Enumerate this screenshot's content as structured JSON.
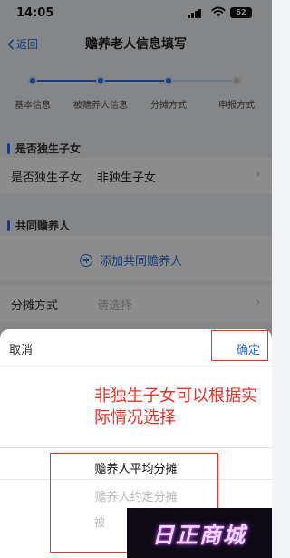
{
  "status_bar": {
    "time": "14:05",
    "battery": "62"
  },
  "nav": {
    "back_label": "返回",
    "title": "赡养老人信息填写"
  },
  "steps": [
    {
      "label": "基本信息",
      "state": "done"
    },
    {
      "label": "被赡养人信息",
      "state": "done"
    },
    {
      "label": "分摊方式",
      "state": "current"
    },
    {
      "label": "申报方式",
      "state": "pending"
    }
  ],
  "only_child_section": {
    "heading": "是否独生子女",
    "row_label": "是否独生子女",
    "row_value": "非独生子女"
  },
  "co_supporter_section": {
    "heading": "共同赡养人",
    "add_label": "添加共同赡养人"
  },
  "allocation_row": {
    "label": "分摊方式",
    "placeholder": "请选择"
  },
  "picker": {
    "cancel_label": "取消",
    "confirm_label": "确定",
    "options": [
      "赡养人平均分摊",
      "赡养人约定分摊",
      "被"
    ],
    "selected_index": 0
  },
  "annotation": {
    "text": "非独生子女可以根据实际情况选择"
  },
  "watermark": {
    "text": "日正商城"
  },
  "colors": {
    "accent": "#2f6fe0",
    "annotation_red": "#e8332a"
  }
}
